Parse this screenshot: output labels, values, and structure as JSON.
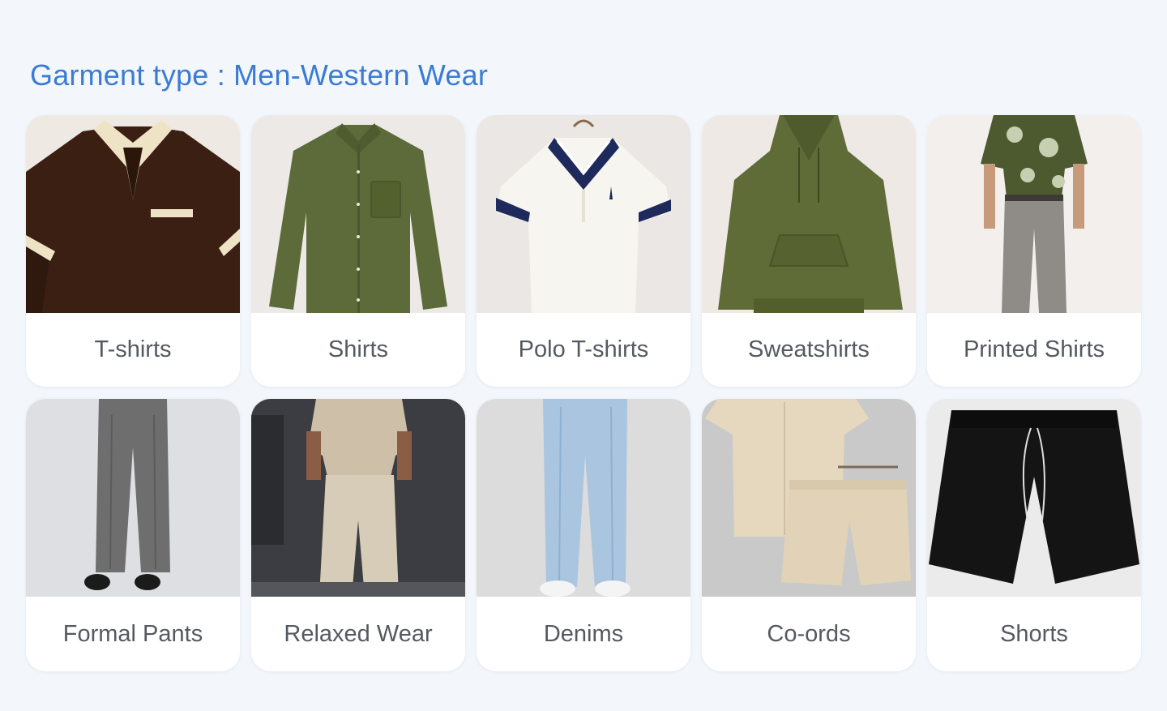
{
  "page": {
    "title": "Garment type : Men-Western Wear"
  },
  "categories": [
    {
      "label": "T-shirts",
      "image": "brown-polo-tshirt-image"
    },
    {
      "label": "Shirts",
      "image": "olive-shirt-image"
    },
    {
      "label": "Polo T-shirts",
      "image": "white-polo-image"
    },
    {
      "label": "Sweatshirts",
      "image": "olive-hoodie-image"
    },
    {
      "label": "Printed Shirts",
      "image": "printed-shirt-model-image"
    },
    {
      "label": "Formal Pants",
      "image": "grey-formal-pants-image"
    },
    {
      "label": "Relaxed Wear",
      "image": "beige-relaxed-wear-image"
    },
    {
      "label": "Denims",
      "image": "light-denim-jeans-image"
    },
    {
      "label": "Co-ords",
      "image": "beige-coord-set-image"
    },
    {
      "label": "Shorts",
      "image": "black-shorts-image"
    }
  ],
  "colors": {
    "accent": "#3a7bd5",
    "background": "#f3f7fc",
    "card": "#ffffff",
    "label_text": "#555a60"
  }
}
